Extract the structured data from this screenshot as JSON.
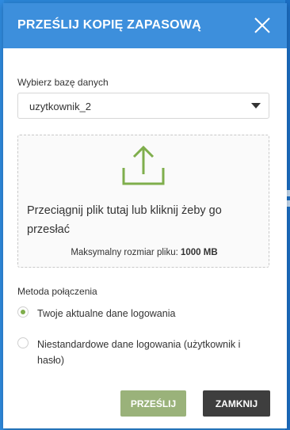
{
  "dialog": {
    "title": "PRZEŚLIJ KOPIĘ ZAPASOWĄ",
    "close_icon": "close-x-icon"
  },
  "database": {
    "label": "Wybierz bazę danych",
    "selected": "uzytkownik_2"
  },
  "dropzone": {
    "icon": "upload-icon",
    "text": "Przeciągnij plik tutaj lub kliknij żeby go przesłać",
    "max_size_label": "Maksymalny rozmiar pliku:",
    "max_size_value": "1000 MB"
  },
  "connection": {
    "label": "Metoda połączenia",
    "options": [
      {
        "label": "Twoje aktualne dane logowania",
        "selected": true
      },
      {
        "label": "Niestandardowe dane logowania (użytkownik i hasło)",
        "selected": false
      }
    ]
  },
  "buttons": {
    "send": "PRZEŚLIJ",
    "close": "ZAMKNIJ"
  },
  "colors": {
    "header": "#3d8fdc",
    "accent_green": "#7fae4c",
    "send_button": "#9ab27a",
    "close_button": "#3e3e3e"
  }
}
